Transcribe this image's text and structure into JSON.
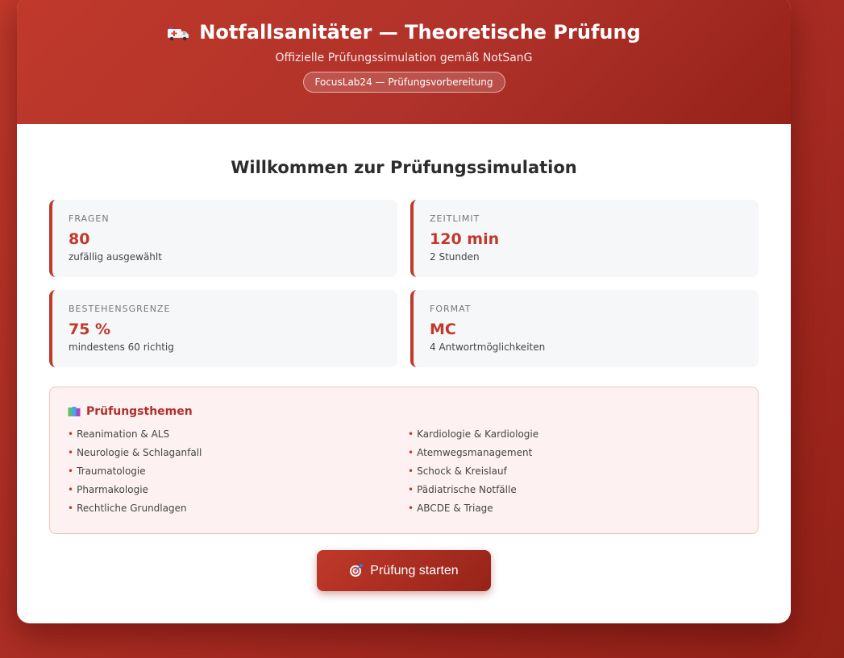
{
  "header": {
    "title": "Notfallsanitäter — Theoretische Prüfung",
    "subtitle": "Offizielle Prüfungssimulation gemäß NotSanG",
    "badge": "FocusLab24 — Prüfungsvorbereitung",
    "icon": "ambulance-icon"
  },
  "welcome": "Willkommen zur Prüfungssimulation",
  "stats": [
    {
      "label": "FRAGEN",
      "value": "80",
      "desc": "zufällig ausgewählt"
    },
    {
      "label": "ZEITLIMIT",
      "value": "120 min",
      "desc": "2 Stunden"
    },
    {
      "label": "BESTEHENSGRENZE",
      "value": "75 %",
      "desc": "mindestens 60 richtig"
    },
    {
      "label": "FORMAT",
      "value": "MC",
      "desc": "4 Antwortmöglichkeiten"
    }
  ],
  "topics": {
    "title": "Prüfungsthemen",
    "icon": "books-icon",
    "items": [
      "Reanimation & ALS",
      "Kardiologie & Kardiologie",
      "Neurologie & Schlaganfall",
      "Atemwegsmanagement",
      "Traumatologie",
      "Schock & Kreislauf",
      "Pharmakologie",
      "Pädiatrische Notfälle",
      "Rechtliche Grundlagen",
      "ABCDE & Triage"
    ]
  },
  "start_button": {
    "label": "Prüfung starten",
    "icon": "target-icon"
  },
  "colors": {
    "accent": "#c0392b",
    "panel": "#f6f7f9",
    "topics_bg": "#fdf2f1"
  }
}
